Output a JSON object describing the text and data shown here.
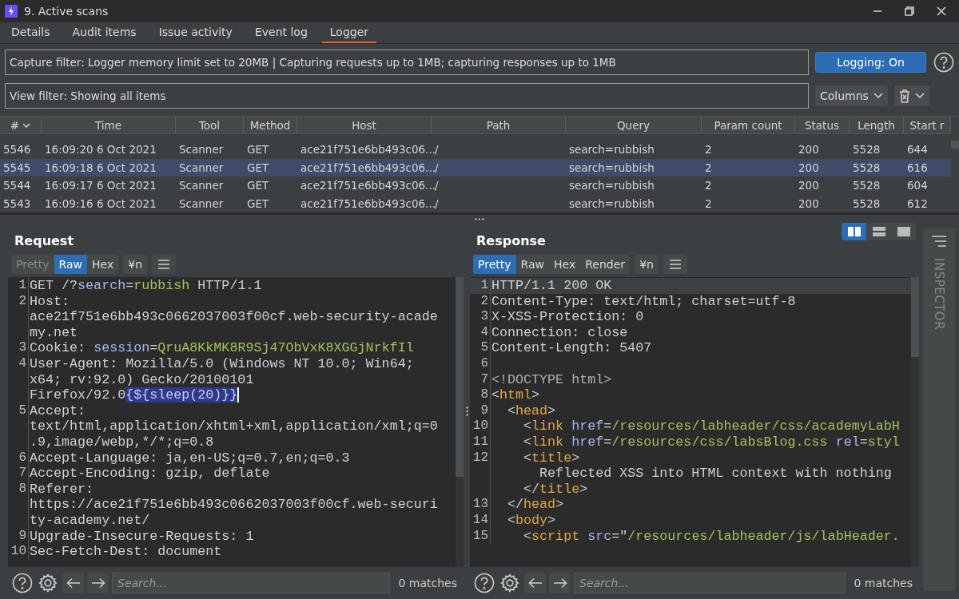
{
  "window": {
    "title": "9. Active scans"
  },
  "tabs": [
    {
      "label": "Details",
      "selected": false
    },
    {
      "label": "Audit items",
      "selected": false
    },
    {
      "label": "Issue activity",
      "selected": false
    },
    {
      "label": "Event log",
      "selected": false
    },
    {
      "label": "Logger",
      "selected": true
    }
  ],
  "capture_filter": "Capture filter: Logger memory limit set to 20MB | Capturing requests up to 1MB;  capturing responses up to 1MB",
  "logging_button": "Logging: On",
  "view_filter": "View filter: Showing all items",
  "columns_button": "Columns",
  "table": {
    "columns": [
      "#",
      "Time",
      "Tool",
      "Method",
      "Host",
      "Path",
      "Query",
      "Param count",
      "Status",
      "Length",
      "Start r"
    ],
    "rows": [
      {
        "selected": false,
        "cells": [
          "5546",
          "16:09:20 6 Oct 2021",
          "Scanner",
          "GET",
          "ace21f751e6bb493c06...",
          "/",
          "search=rubbish",
          "2",
          "200",
          "5528",
          "644"
        ]
      },
      {
        "selected": true,
        "cells": [
          "5545",
          "16:09:18 6 Oct 2021",
          "Scanner",
          "GET",
          "ace21f751e6bb493c06...",
          "/",
          "search=rubbish",
          "2",
          "200",
          "5528",
          "616"
        ]
      },
      {
        "selected": false,
        "cells": [
          "5544",
          "16:09:17 6 Oct 2021",
          "Scanner",
          "GET",
          "ace21f751e6bb493c06...",
          "/",
          "search=rubbish",
          "2",
          "200",
          "5528",
          "604"
        ]
      },
      {
        "selected": false,
        "cells": [
          "5543",
          "16:09:16 6 Oct 2021",
          "Scanner",
          "GET",
          "ace21f751e6bb493c06...",
          "/",
          "search=rubbish",
          "2",
          "200",
          "5528",
          "612"
        ]
      }
    ]
  },
  "request": {
    "title": "Request",
    "tabs": [
      {
        "label": "Pretty",
        "selected": false,
        "disabled": true
      },
      {
        "label": "Raw",
        "selected": true,
        "disabled": false
      },
      {
        "label": "Hex",
        "selected": false,
        "disabled": false
      }
    ],
    "newline_button": "¥n",
    "lines": [
      {
        "number": "1",
        "segments": [
          {
            "text": "GET /?",
            "kind": "plain"
          },
          {
            "text": "search",
            "kind": "key"
          },
          {
            "text": "=",
            "kind": "plain"
          },
          {
            "text": "rubbish",
            "kind": "value"
          },
          {
            "text": " HTTP/1.1",
            "kind": "plain"
          }
        ]
      },
      {
        "number": "2",
        "segments": [
          {
            "text": "Host:",
            "kind": "plain"
          }
        ]
      },
      {
        "segments": [
          {
            "text": "ace21f751e6bb493c0662037003f00cf.web-security-acade",
            "kind": "plain"
          }
        ]
      },
      {
        "segments": [
          {
            "text": "my.net",
            "kind": "plain"
          }
        ]
      },
      {
        "number": "3",
        "segments": [
          {
            "text": "Cookie: ",
            "kind": "plain"
          },
          {
            "text": "session",
            "kind": "key"
          },
          {
            "text": "=",
            "kind": "plain"
          },
          {
            "text": "QruA8KkMK8R9Sj47ObVxK8XGGjNrkfIl",
            "kind": "value"
          }
        ]
      },
      {
        "number": "4",
        "segments": [
          {
            "text": "User-Agent: Mozilla/5.0 (Windows NT 10.0; Win64;",
            "kind": "plain"
          }
        ]
      },
      {
        "segments": [
          {
            "text": "x64; rv:92.0) Gecko/20100101",
            "kind": "plain"
          }
        ]
      },
      {
        "segments": [
          {
            "text": "Firefox/92.0",
            "kind": "plain"
          },
          {
            "text": "{${sleep(20)}}",
            "kind": "highlight"
          }
        ]
      },
      {
        "number": "5",
        "segments": [
          {
            "text": "Accept:",
            "kind": "plain"
          }
        ]
      },
      {
        "segments": [
          {
            "text": "text/html,application/xhtml+xml,application/xml;q=0",
            "kind": "plain"
          }
        ]
      },
      {
        "segments": [
          {
            "text": ".9,image/webp,*/*;q=0.8",
            "kind": "plain"
          }
        ]
      },
      {
        "number": "6",
        "segments": [
          {
            "text": "Accept-Language: ja,en-US;q=0.7,en;q=0.3",
            "kind": "plain"
          }
        ]
      },
      {
        "number": "7",
        "segments": [
          {
            "text": "Accept-Encoding: gzip, deflate",
            "kind": "plain"
          }
        ]
      },
      {
        "number": "8",
        "segments": [
          {
            "text": "Referer:",
            "kind": "plain"
          }
        ]
      },
      {
        "segments": [
          {
            "text": "https://ace21f751e6bb493c0662037003f00cf.web-securi",
            "kind": "plain"
          }
        ]
      },
      {
        "segments": [
          {
            "text": "ty-academy.net/",
            "kind": "plain"
          }
        ]
      },
      {
        "number": "9",
        "segments": [
          {
            "text": "Upgrade-Insecure-Requests: 1",
            "kind": "plain"
          }
        ]
      },
      {
        "number": "10",
        "segments": [
          {
            "text": "Sec-Fetch-Dest: document",
            "kind": "plain"
          }
        ]
      }
    ],
    "search": {
      "placeholder": "Search..."
    },
    "matches": "0 matches"
  },
  "response": {
    "title": "Response",
    "tabs": [
      {
        "label": "Pretty",
        "selected": true,
        "disabled": false
      },
      {
        "label": "Raw",
        "selected": false,
        "disabled": false
      },
      {
        "label": "Hex",
        "selected": false,
        "disabled": false
      },
      {
        "label": "Render",
        "selected": false,
        "disabled": false
      }
    ],
    "newline_button": "¥n",
    "lines": [
      {
        "number": "1",
        "current": true,
        "segments": [
          {
            "text": "HTTP/1.1 200 OK",
            "kind": "plain"
          }
        ]
      },
      {
        "number": "2",
        "current": false,
        "segments": [
          {
            "text": "Content-Type: text/html; charset=utf-8",
            "kind": "plain"
          }
        ]
      },
      {
        "number": "3",
        "current": false,
        "segments": [
          {
            "text": "X-XSS-Protection: 0",
            "kind": "plain"
          }
        ]
      },
      {
        "number": "4",
        "current": false,
        "segments": [
          {
            "text": "Connection: close",
            "kind": "plain"
          }
        ]
      },
      {
        "number": "5",
        "current": false,
        "segments": [
          {
            "text": "Content-Length: 5407",
            "kind": "plain"
          }
        ]
      },
      {
        "number": "6",
        "current": false
      },
      {
        "number": "7",
        "current": false,
        "segments": [
          {
            "text": "<!DOCTYPE html>",
            "kind": "doctype"
          }
        ]
      },
      {
        "number": "8",
        "current": false,
        "segments": [
          {
            "text": "<",
            "kind": "plain"
          },
          {
            "text": "html",
            "kind": "tag"
          },
          {
            "text": ">",
            "kind": "plain"
          }
        ]
      },
      {
        "number": "9",
        "current": false,
        "segments": [
          {
            "text": "  <",
            "kind": "plain"
          },
          {
            "text": "head",
            "kind": "tag"
          },
          {
            "text": ">",
            "kind": "plain"
          }
        ]
      },
      {
        "number": "10",
        "current": false,
        "segments": [
          {
            "text": "    <",
            "kind": "plain"
          },
          {
            "text": "link",
            "kind": "tag"
          },
          {
            "text": " href",
            "kind": "key"
          },
          {
            "text": "=",
            "kind": "plain"
          },
          {
            "text": "/resources/labheader/css/academyLabH",
            "kind": "value"
          }
        ]
      },
      {
        "number": "11",
        "current": false,
        "segments": [
          {
            "text": "    <",
            "kind": "plain"
          },
          {
            "text": "link",
            "kind": "tag"
          },
          {
            "text": " href",
            "kind": "key"
          },
          {
            "text": "=",
            "kind": "plain"
          },
          {
            "text": "/resources/css/labsBlog.css",
            "kind": "value"
          },
          {
            "text": " rel",
            "kind": "key"
          },
          {
            "text": "=",
            "kind": "plain"
          },
          {
            "text": "styl",
            "kind": "value"
          }
        ]
      },
      {
        "number": "12",
        "current": false,
        "segments": [
          {
            "text": "    <",
            "kind": "plain"
          },
          {
            "text": "title",
            "kind": "tag"
          },
          {
            "text": ">",
            "kind": "plain"
          }
        ]
      },
      {
        "current": false,
        "segments": [
          {
            "text": "      Reflected XSS into HTML context with nothing",
            "kind": "plain"
          }
        ]
      },
      {
        "current": false,
        "segments": [
          {
            "text": "    </",
            "kind": "plain"
          },
          {
            "text": "title",
            "kind": "tag"
          },
          {
            "text": ">",
            "kind": "plain"
          }
        ]
      },
      {
        "number": "13",
        "current": false,
        "segments": [
          {
            "text": "  </",
            "kind": "plain"
          },
          {
            "text": "head",
            "kind": "tag"
          },
          {
            "text": ">",
            "kind": "plain"
          }
        ]
      },
      {
        "number": "14",
        "current": false,
        "segments": [
          {
            "text": "  <",
            "kind": "plain"
          },
          {
            "text": "body",
            "kind": "tag"
          },
          {
            "text": ">",
            "kind": "plain"
          }
        ]
      },
      {
        "number": "15",
        "current": false,
        "segments": [
          {
            "text": "    <",
            "kind": "plain"
          },
          {
            "text": "script",
            "kind": "tag"
          },
          {
            "text": " src",
            "kind": "key"
          },
          {
            "text": "=\"",
            "kind": "plain"
          },
          {
            "text": "/resources/labheader/js/labHeader.",
            "kind": "value"
          }
        ]
      }
    ],
    "search": {
      "placeholder": "Search..."
    },
    "matches": "0 matches"
  },
  "layout_buttons": [
    {
      "kind": "columns",
      "selected": true
    },
    {
      "kind": "rows",
      "selected": false
    },
    {
      "kind": "single",
      "selected": false
    }
  ],
  "inspector": {
    "label": "INSPECTOR"
  }
}
